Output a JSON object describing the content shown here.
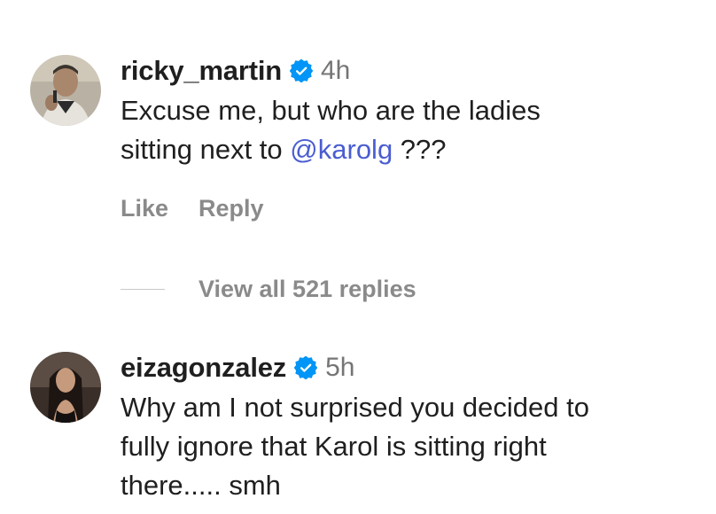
{
  "comments": [
    {
      "username": "ricky_martin",
      "time": "4h",
      "text_line1": "Excuse me, but who are the ladies",
      "text_line2_prefix": "sitting next to ",
      "mention": "@karolg",
      "text_line2_suffix": " ???",
      "like_label": "Like",
      "reply_label": "Reply"
    },
    {
      "username": "eizagonzalez",
      "time": "5h",
      "text_line1": "Why am I not surprised you decided to",
      "text_line2": "fully ignore that Karol is sitting right",
      "text_line3": "there..... smh"
    }
  ],
  "view_replies_label": "View all 521 replies",
  "icons": {
    "verified": "verified-badge-icon"
  },
  "colors": {
    "verified_blue": "#0095f6",
    "mention": "#4a5dd0",
    "secondary_text": "#8a8a8a"
  }
}
